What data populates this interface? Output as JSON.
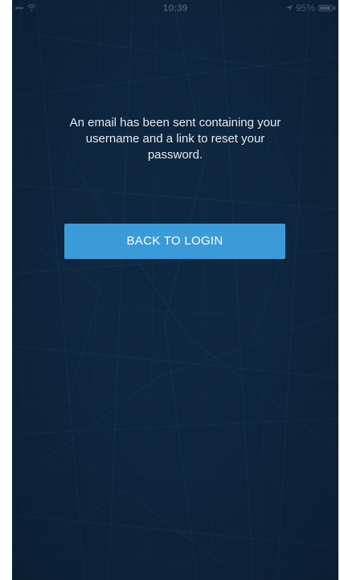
{
  "status_bar": {
    "time": "10:39",
    "battery_percent": "95%",
    "battery_level": 0.95,
    "signal_icon": "signal-icon",
    "wifi_icon": "wifi-icon",
    "location_icon": "location-arrow-icon"
  },
  "main": {
    "message": "An email has been sent containing your username and a link to reset your password.",
    "back_button_label": "BACK TO LOGIN"
  },
  "colors": {
    "background": "#0e2740",
    "map_lines": "#1c3a57",
    "button": "#3a9bd8",
    "message_text": "#e3eaf1"
  }
}
